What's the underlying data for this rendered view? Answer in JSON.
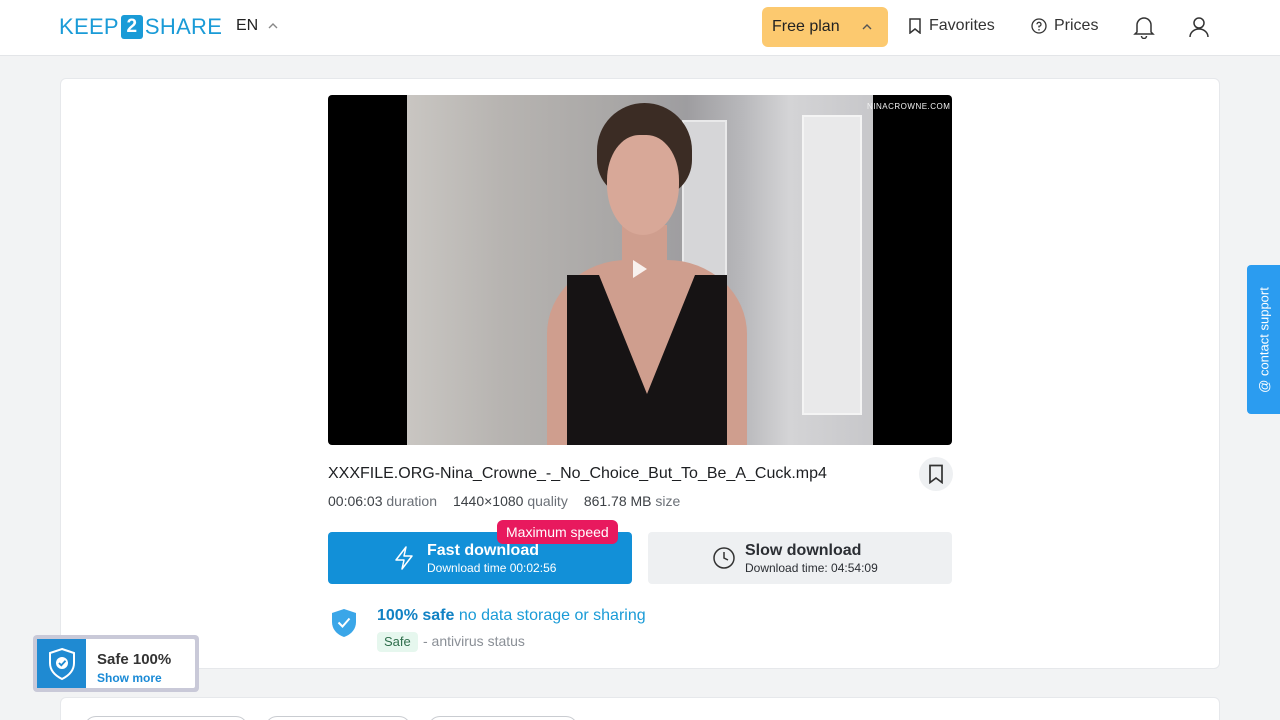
{
  "header": {
    "logo": {
      "left": "KEEP",
      "mid": "2",
      "right": "SHARE"
    },
    "lang": "EN",
    "plan": "Free plan",
    "favorites": "Favorites",
    "prices": "Prices"
  },
  "video": {
    "watermark": "NINACROWNE.COM"
  },
  "file": {
    "name": "XXXFILE.ORG-Nina_Crowne_-_No_Choice_But_To_Be_A_Cuck.mp4",
    "duration_value": "00:06:03",
    "duration_label": "duration",
    "quality_value": "1440×1080",
    "quality_label": "quality",
    "size_value": "861.78 MB",
    "size_label": "size"
  },
  "download": {
    "badge": "Maximum speed",
    "fast_title": "Fast download",
    "fast_sub": "Download time 00:02:56",
    "slow_title": "Slow download",
    "slow_sub": "Download time: 04:54:09"
  },
  "safety": {
    "bold": "100% safe",
    "rest": "no data storage or sharing",
    "tag": "Safe",
    "status": "- antivirus status"
  },
  "contact": "@ contact support",
  "widget": {
    "title": "Safe 100%",
    "link": "Show more"
  },
  "colors": {
    "accent": "#1290d8",
    "plan": "#fcc96f",
    "badge": "#e8195e",
    "contact": "#2b9cf0"
  }
}
